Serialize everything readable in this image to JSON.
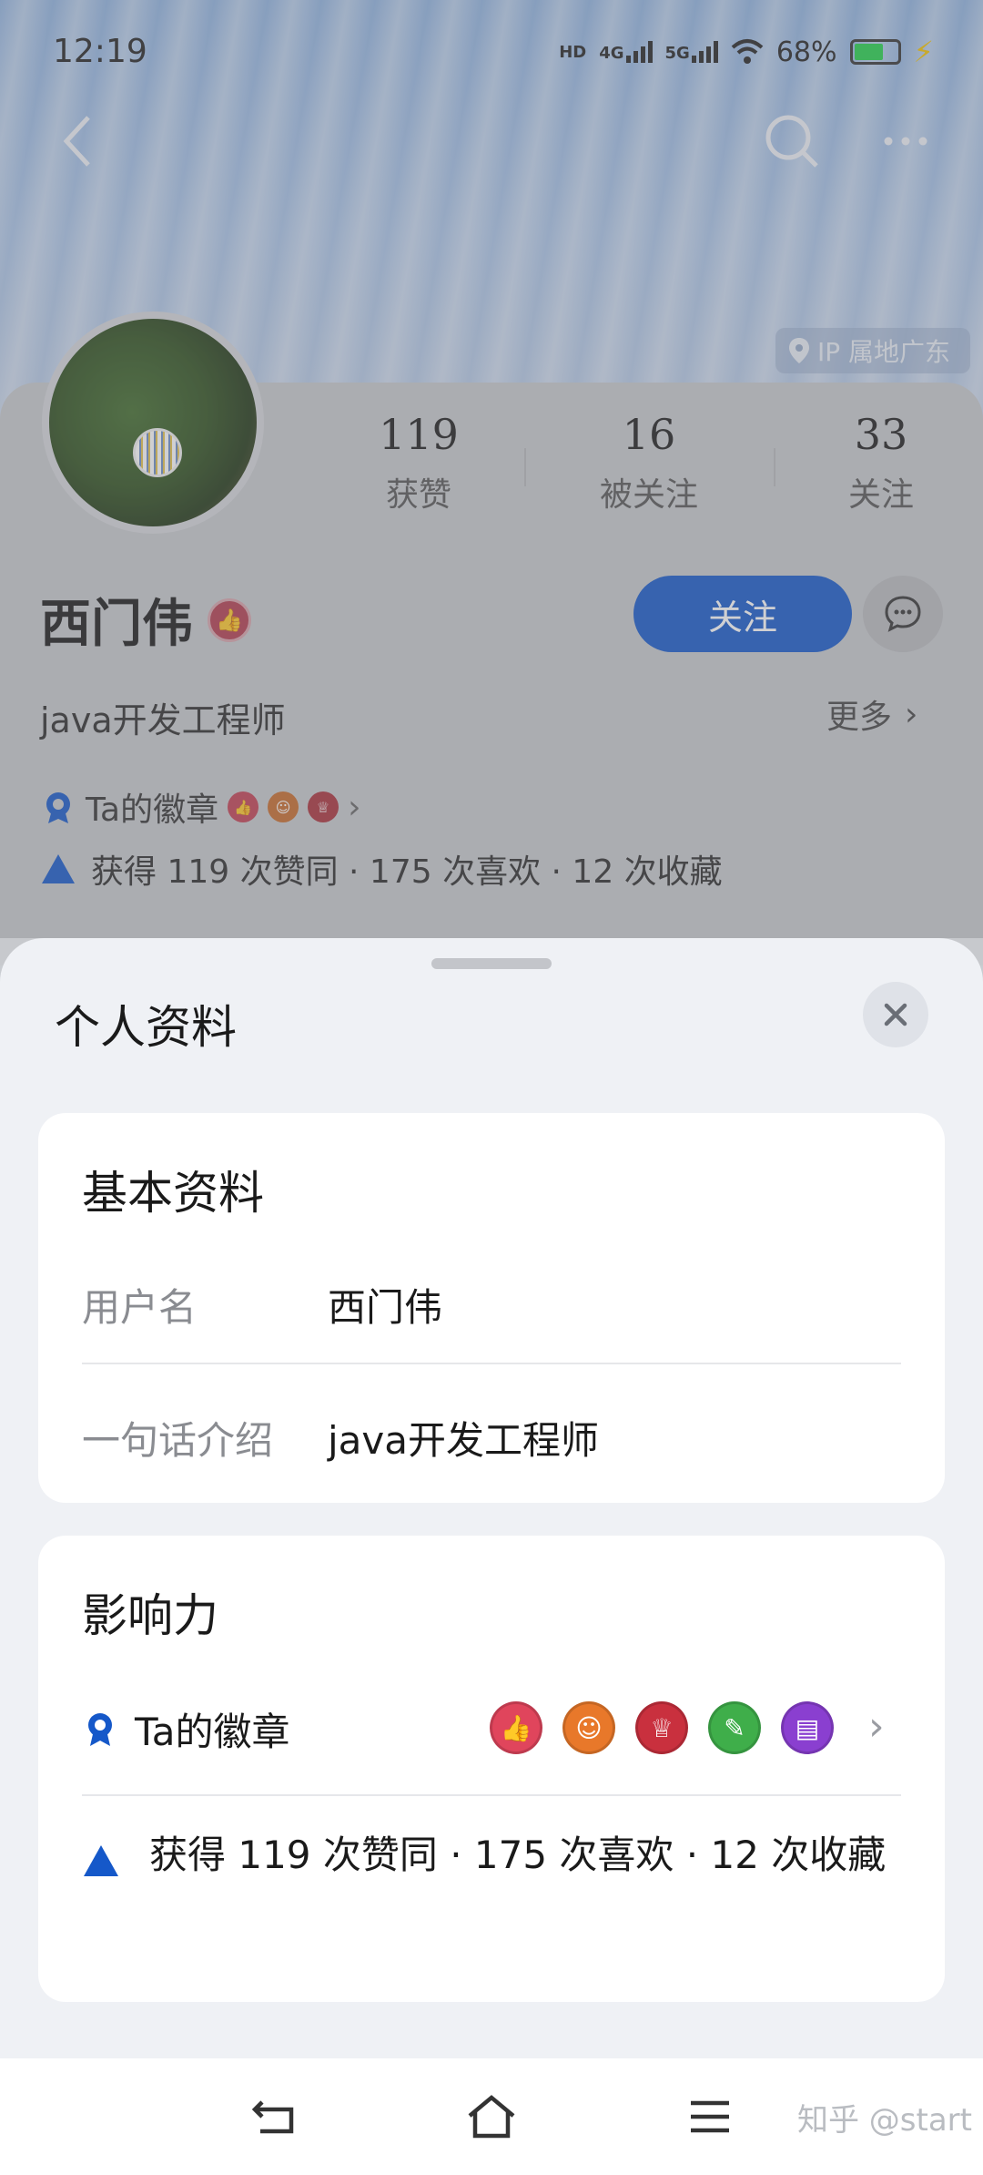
{
  "status_bar": {
    "time": "12:19",
    "hd_label": "HD",
    "net1": "4G",
    "net2": "5G",
    "battery_pct": "68%",
    "battery_color": "#22d14a"
  },
  "top_bar": {
    "back_icon": "back-arrow-icon",
    "search_icon": "search-icon",
    "more_icon": "more-dots-icon"
  },
  "ip_location": "IP 属地广东",
  "profile": {
    "stats": [
      {
        "value": "119",
        "label": "获赞"
      },
      {
        "value": "16",
        "label": "被关注"
      },
      {
        "value": "33",
        "label": "关注"
      }
    ],
    "name": "西门伟",
    "follow_label": "关注",
    "bio": "java开发工程师",
    "more_label": "更多",
    "badge_link_label": "Ta的徽章",
    "activity": "获得 119 次赞同 · 175 次喜欢 · 12 次收藏",
    "accent_color": "#1558c9"
  },
  "sheet": {
    "title": "个人资料",
    "basic": {
      "title": "基本资料",
      "fields": [
        {
          "label": "用户名",
          "value": "西门伟"
        },
        {
          "label": "一句话介绍",
          "value": "java开发工程师"
        }
      ]
    },
    "influence": {
      "title": "影响力",
      "badges_label": "Ta的徽章",
      "badges": [
        {
          "icon": "thumbs-up-badge-icon",
          "color": "#e0455c"
        },
        {
          "icon": "person-badge-icon",
          "color": "#e8782a"
        },
        {
          "icon": "trophy-badge-icon",
          "color": "#c9303e"
        },
        {
          "icon": "pencil-badge-icon",
          "color": "#3fae4a"
        },
        {
          "icon": "comment-badge-icon",
          "color": "#8a3fd0"
        }
      ],
      "stats_text": "获得 119 次赞同 · 175 次喜欢 · 12 次收藏"
    }
  },
  "nav": {
    "watermark": "知乎 @start"
  }
}
